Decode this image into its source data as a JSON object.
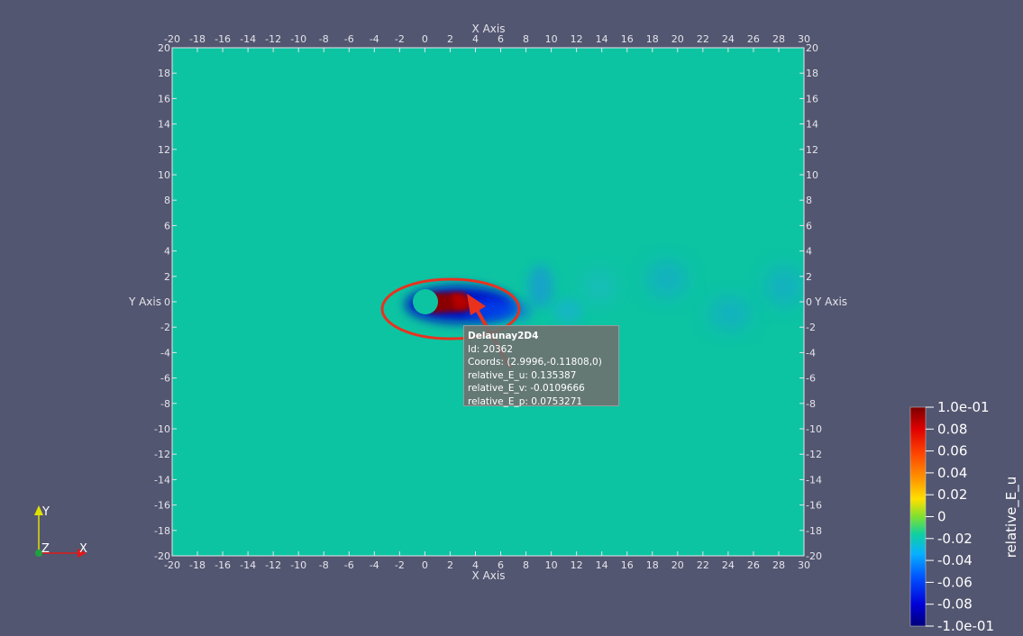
{
  "axes": {
    "x_title": "X Axis",
    "y_title": "Y Axis",
    "x_ticks": [
      "-20",
      "-18",
      "-16",
      "-14",
      "-12",
      "-10",
      "-8",
      "-6",
      "-4",
      "-2",
      "0",
      "2",
      "4",
      "6",
      "8",
      "10",
      "12",
      "14",
      "16",
      "18",
      "20",
      "22",
      "24",
      "26",
      "28",
      "30"
    ],
    "y_ticks": [
      "20",
      "18",
      "16",
      "14",
      "12",
      "10",
      "8",
      "6",
      "4",
      "2",
      "0",
      "-2",
      "-4",
      "-6",
      "-8",
      "-10",
      "-12",
      "-14",
      "-16",
      "-18",
      "-20"
    ]
  },
  "tooltip": {
    "title": "Delaunay2D4",
    "id": "Id: 20362",
    "coords": "Coords: (2.9996,-0.11808,0)",
    "e_u": "relative_E_u: 0.135387",
    "e_v": "relative_E_v: -0.0109666",
    "e_p": "relative_E_p: 0.0753271"
  },
  "colorbar": {
    "title": "relative_E_u",
    "labels": [
      "1.0e-01",
      "0.08",
      "0.06",
      "0.04",
      "0.02",
      "0",
      "-0.02",
      "-0.04",
      "-0.06",
      "-0.08",
      "-1.0e-01"
    ]
  },
  "orientation": {
    "x": "X",
    "y": "Y",
    "z": "Z"
  },
  "colors": {
    "background": "#535670",
    "field": "#0cc4a2",
    "annotation": "#e8321e"
  }
}
